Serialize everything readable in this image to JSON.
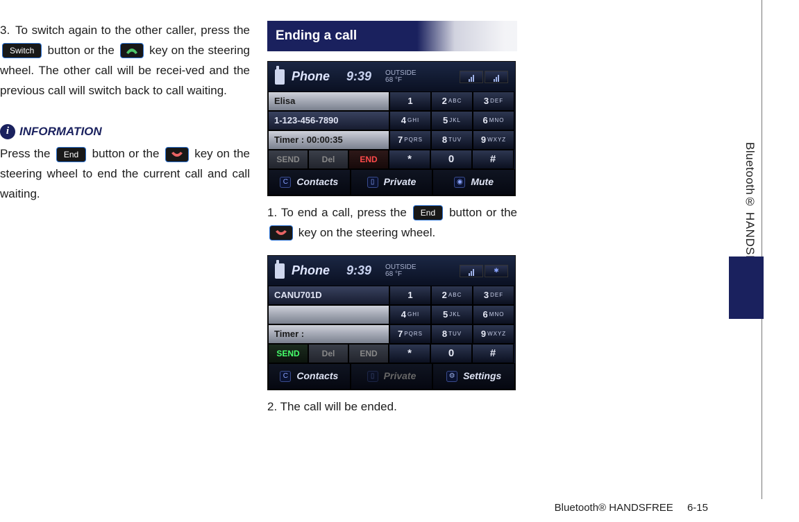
{
  "sideTab": "Bluetooth® HANDSFREE",
  "col1": {
    "step3_num": "3.",
    "step3_a": "To switch again to the other caller, press the ",
    "switch_btn": "Switch",
    "step3_b": " button or the ",
    "step3_c": " key on the steering wheel. The other call will be recei-ved and the previous call will switch back to call waiting.",
    "info_title": "INFORMATION",
    "info_a": "Press the ",
    "end_btn": "End",
    "info_b": " button or the ",
    "info_c": " key on the steering wheel to end the current call and call waiting."
  },
  "col2": {
    "section_title": "Ending a call",
    "step1_num": "1.",
    "step1_a": "To end a call, press the ",
    "end_btn": "End",
    "step1_b": " button or the  ",
    "step1_c": " key on the steering wheel.",
    "step2": "2. The call will be ended."
  },
  "shot1": {
    "title": "Phone",
    "time": "9:39",
    "temp_top": "OUTSIDE",
    "temp_val": "68 °F",
    "left": [
      "Elisa",
      "1-123-456-7890",
      "Timer : 00:00:35"
    ],
    "keys": [
      [
        "1",
        ""
      ],
      [
        "2",
        "ABC"
      ],
      [
        "3",
        "DEF"
      ],
      [
        "4",
        "GHI"
      ],
      [
        "5",
        "JKL"
      ],
      [
        "6",
        "MNO"
      ],
      [
        "7",
        "PQRS"
      ],
      [
        "8",
        "TUV"
      ],
      [
        "9",
        "WXYZ"
      ],
      [
        "*",
        ""
      ],
      [
        "0",
        ""
      ],
      [
        "#",
        ""
      ]
    ],
    "actions": [
      "SEND",
      "Del",
      "END"
    ],
    "bottom": [
      "Contacts",
      "Private",
      "Mute"
    ]
  },
  "shot2": {
    "title": "Phone",
    "time": "9:39",
    "temp_top": "OUTSIDE",
    "temp_val": "68 °F",
    "left": [
      "CANU701D",
      "",
      "Timer :"
    ],
    "keys": [
      [
        "1",
        ""
      ],
      [
        "2",
        "ABC"
      ],
      [
        "3",
        "DEF"
      ],
      [
        "4",
        "GHI"
      ],
      [
        "5",
        "JKL"
      ],
      [
        "6",
        "MNO"
      ],
      [
        "7",
        "PQRS"
      ],
      [
        "8",
        "TUV"
      ],
      [
        "9",
        "WXYZ"
      ],
      [
        "*",
        ""
      ],
      [
        "0",
        ""
      ],
      [
        "#",
        ""
      ]
    ],
    "actions": [
      "SEND",
      "Del",
      "END"
    ],
    "bottom": [
      "Contacts",
      "Private",
      "Settings"
    ]
  },
  "footer": {
    "section": "Bluetooth® HANDSFREE",
    "page": "6-15"
  }
}
